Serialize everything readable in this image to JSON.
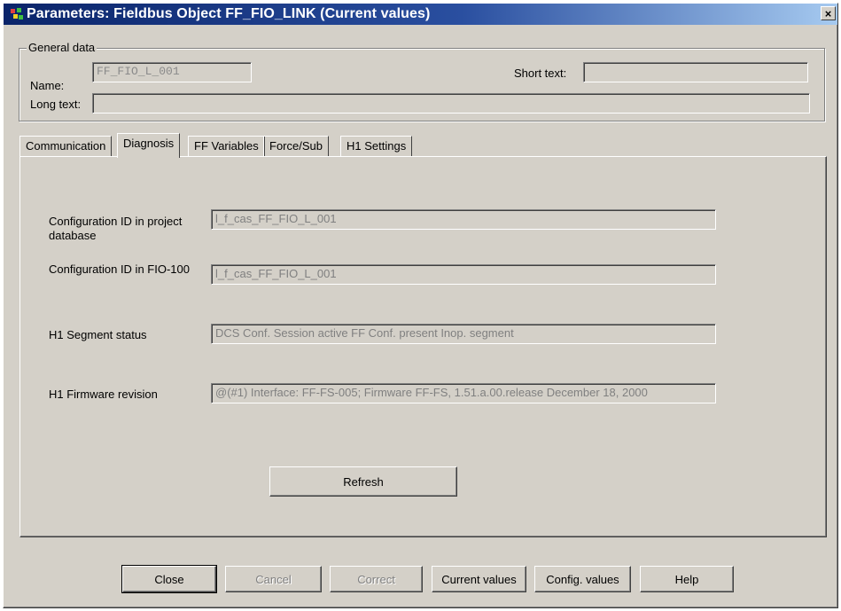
{
  "window": {
    "title": "Parameters: Fieldbus Object FF_FIO_LINK (Current values)",
    "close_glyph": "×"
  },
  "general": {
    "legend": "General data",
    "name_label": "Name:",
    "name_value": "FF_FIO_L_001",
    "short_text_label": "Short text:",
    "short_text_value": "",
    "long_text_label": "Long text:",
    "long_text_value": ""
  },
  "tabs": [
    {
      "label": "Communication",
      "active": false
    },
    {
      "label": "Diagnosis",
      "active": true
    },
    {
      "label": "FF Variables",
      "active": false
    },
    {
      "label": "Force/Sub",
      "active": false
    },
    {
      "label": "H1 Settings",
      "active": false
    }
  ],
  "diagnosis": {
    "config_id_project_label": "Configuration ID in project database",
    "config_id_project_value": "l_f_cas_FF_FIO_L_001",
    "config_id_fio_label": "Configuration ID in FIO-100",
    "config_id_fio_value": "l_f_cas_FF_FIO_L_001",
    "segment_status_label": "H1 Segment status",
    "segment_status_value": "DCS Conf. Session active  FF Conf. present  Inop. segment",
    "firmware_label": "H1 Firmware revision",
    "firmware_value": "@(#1) Interface: FF-FS-005; Firmware FF-FS, 1.51.a.00.release December 18, 2000",
    "refresh_label": "Refresh"
  },
  "buttons": {
    "close": "Close",
    "cancel": "Cancel",
    "correct": "Correct",
    "current_values": "Current values",
    "config_values": "Config. values",
    "help": "Help"
  },
  "colors": {
    "title_bar": "#0a246a",
    "face": "#d4d0c8",
    "disabled_text": "#808080"
  }
}
